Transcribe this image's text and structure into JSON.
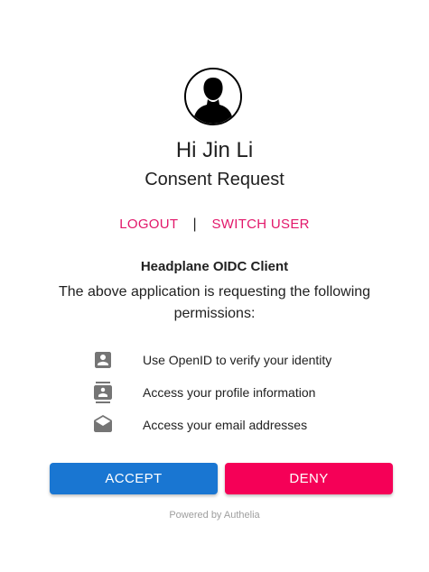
{
  "user": {
    "greeting": "Hi Jin Li"
  },
  "page": {
    "subtitle": "Consent Request"
  },
  "links": {
    "logout": "LOGOUT",
    "separator": "|",
    "switch_user": "SWITCH USER"
  },
  "client": {
    "name": "Headplane OIDC Client",
    "description": "The above application is requesting the following permissions:"
  },
  "permissions": [
    {
      "icon": "account-box-icon",
      "label": "Use OpenID to verify your identity"
    },
    {
      "icon": "contacts-icon",
      "label": "Access your profile information"
    },
    {
      "icon": "drafts-icon",
      "label": "Access your email addresses"
    }
  ],
  "buttons": {
    "accept": "ACCEPT",
    "deny": "DENY"
  },
  "footer": {
    "powered_by": "Powered by Authelia"
  },
  "colors": {
    "link": "#e2176a",
    "accept": "#1976d2",
    "deny": "#f50057",
    "icon": "#757575",
    "text": "#212121",
    "muted": "#9e9e9e"
  }
}
